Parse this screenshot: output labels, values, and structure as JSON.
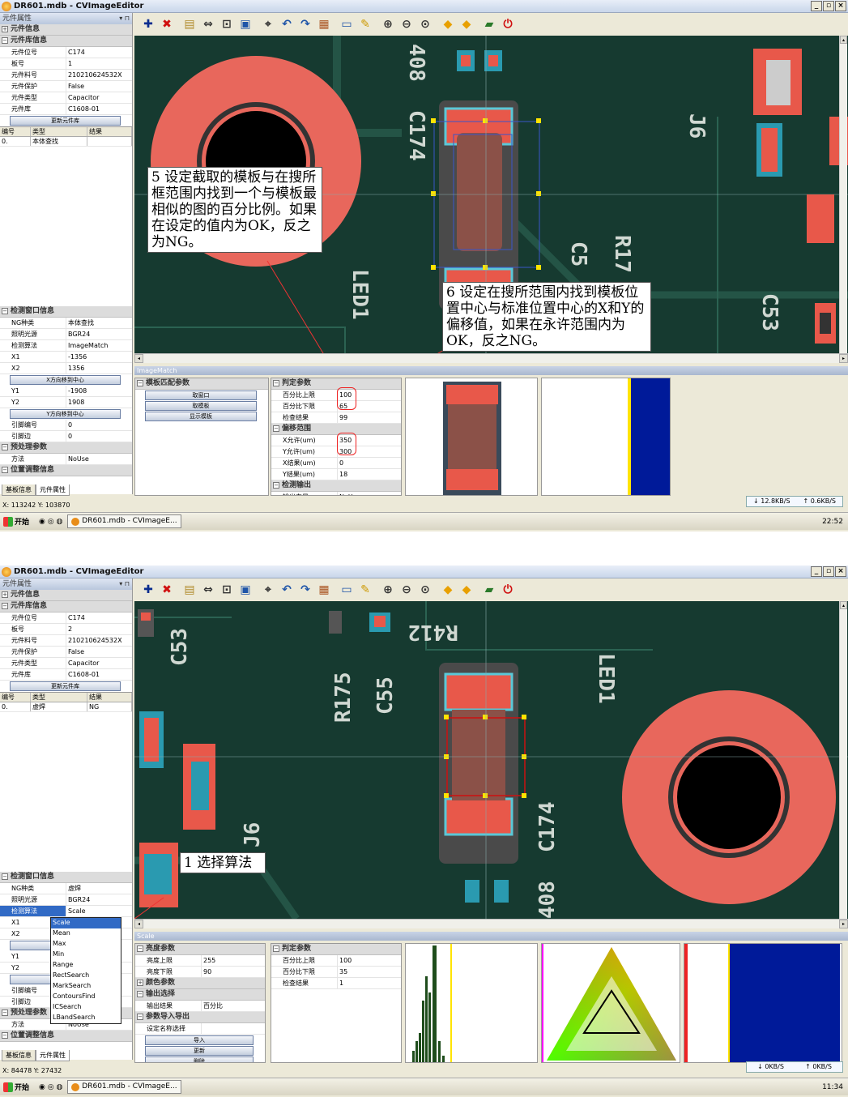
{
  "screen_top": {
    "window_title": "DR601.mdb - CVImageEditor",
    "left_panel_title": "元件属性",
    "sections_top": [
      {
        "label": "元件信息",
        "sign": "+"
      },
      {
        "label": "元件库信息",
        "sign": "−"
      }
    ],
    "component_rows": [
      {
        "k": "元件位号",
        "v": "C174"
      },
      {
        "k": "板号",
        "v": "1"
      },
      {
        "k": "元件料号",
        "v": "21021062453​2X"
      },
      {
        "k": "元件保护",
        "v": "False"
      },
      {
        "k": "元件类型",
        "v": "Capacitor"
      },
      {
        "k": "元件库",
        "v": "C1608-01"
      }
    ],
    "update_button": "更新元件库",
    "grid_headers": [
      "编号",
      "类型",
      "结果"
    ],
    "grid_rows": [
      {
        "id": "0.",
        "type": "本体查找",
        "result": ""
      }
    ],
    "detect_section": "检测窗口信息",
    "detect_rows": [
      {
        "k": "NG种类",
        "v": "本体查找"
      },
      {
        "k": "照明光源",
        "v": "BGR24"
      },
      {
        "k": "检测算法",
        "v": "ImageMatch"
      },
      {
        "k": "X1",
        "v": "-1356"
      },
      {
        "k": "X2",
        "v": "1356"
      }
    ],
    "x_center_button": "X方向移到中心",
    "detect_rows_2": [
      {
        "k": "Y1",
        "v": "-1908"
      },
      {
        "k": "Y2",
        "v": "1908"
      }
    ],
    "y_center_button": "Y方向移到中心",
    "detect_rows_3": [
      {
        "k": "引脚编号",
        "v": "0"
      },
      {
        "k": "引脚边",
        "v": "0"
      }
    ],
    "pre_section": "预处理参数",
    "pre_rows": [
      {
        "k": "方法",
        "v": "NoUse"
      }
    ],
    "pos_section": "位置调整信息",
    "tabs": [
      "基板信息",
      "元件属性"
    ],
    "status_coords": "X: 113242 Y: 103870",
    "bottom_title": "ImageMatch",
    "tm_section": "模板匹配参数",
    "tm_buttons": [
      "取窗口",
      "取模板",
      "显示模板"
    ],
    "judge_section": "判定参数",
    "judge_rows": [
      {
        "k": "百分比上限",
        "v": "100"
      },
      {
        "k": "百分比下限",
        "v": "65"
      },
      {
        "k": "检查结果",
        "v": "99"
      }
    ],
    "offset_section": "偏移范围",
    "offset_rows": [
      {
        "k": "X允许(um)",
        "v": "350"
      },
      {
        "k": "Y允许(um)",
        "v": "300"
      },
      {
        "k": "X结果(um)",
        "v": "0"
      },
      {
        "k": "Y结果(um)",
        "v": "18"
      }
    ],
    "output_section": "检测输出",
    "output_rows": [
      {
        "k": "输出向量",
        "v": "NoUse"
      }
    ],
    "callout5": "5 设定截取的模板与在搜所框范围内找到一个与模板最相似的图的百分比例。如果在设定的值内为OK，反之为NG。",
    "callout6": "6 设定在搜所范围内找到模板位置中心与标准位置中心的X和Y的偏移值，如果在永许范围内为OK，反之NG。",
    "silk_labels": [
      "LED1",
      "C174",
      "C5",
      "R17",
      "J6",
      "C53",
      "408"
    ],
    "net_down": "12.8KB/S",
    "net_up": "0.6KB/S",
    "start": "开始",
    "task_item": "DR601.mdb - CVImageE...",
    "clock": "22:52"
  },
  "screen_bottom": {
    "window_title": "DR601.mdb - CVImageEditor",
    "left_panel_title": "元件属性",
    "sections_top": [
      {
        "label": "元件信息",
        "sign": "+"
      },
      {
        "label": "元件库信息",
        "sign": "−"
      }
    ],
    "component_rows": [
      {
        "k": "元件位号",
        "v": "C174"
      },
      {
        "k": "板号",
        "v": "2"
      },
      {
        "k": "元件料号",
        "v": "21021062453​2X"
      },
      {
        "k": "元件保护",
        "v": "False"
      },
      {
        "k": "元件类型",
        "v": "Capacitor"
      },
      {
        "k": "元件库",
        "v": "C1608-01"
      }
    ],
    "update_button": "更新元件库",
    "grid_headers": [
      "编号",
      "类型",
      "结果"
    ],
    "grid_rows": [
      {
        "id": "0.",
        "type": "虚焊",
        "result": "NG"
      }
    ],
    "detect_section": "检测窗口信息",
    "detect_rows": [
      {
        "k": "NG种类",
        "v": "虚焊"
      },
      {
        "k": "照明光源",
        "v": "BGR24"
      },
      {
        "k": "检测算法",
        "v": "Scale"
      },
      {
        "k": "X1",
        "v": ""
      },
      {
        "k": "X2",
        "v": ""
      }
    ],
    "detect_rows_2": [
      {
        "k": "Y1",
        "v": ""
      },
      {
        "k": "Y2",
        "v": ""
      }
    ],
    "detect_rows_3": [
      {
        "k": "引脚编号",
        "v": ""
      },
      {
        "k": "引脚边",
        "v": ""
      }
    ],
    "pre_section": "预处理参数",
    "pre_rows": [
      {
        "k": "方法",
        "v": "NoUse"
      }
    ],
    "pos_section": "位置调整信息",
    "algo_options": [
      "Scale",
      "Mean",
      "Max",
      "Min",
      "Range",
      "RectSearch",
      "MarkSearch",
      "ContoursFind",
      "ICSearch",
      "LBandSearch"
    ],
    "tabs": [
      "基板信息",
      "元件属性"
    ],
    "status_coords": "X: 84478 Y: 27432",
    "bottom_title": "Scale",
    "bright_section": "亮度参数",
    "bright_rows": [
      {
        "k": "亮度上限",
        "v": "255"
      },
      {
        "k": "亮度下限",
        "v": "90"
      }
    ],
    "color_section": "颜色参数",
    "out_section": "输出选择",
    "out_rows": [
      {
        "k": "输出结果",
        "v": "百分比"
      }
    ],
    "io_section": "参数导入导出",
    "io_rows": [
      {
        "k": "设定名称选择",
        "v": ""
      }
    ],
    "io_buttons": [
      "导入",
      "更新",
      "删除"
    ],
    "judge_section": "判定参数",
    "judge_rows": [
      {
        "k": "百分比上限",
        "v": "100"
      },
      {
        "k": "百分比下限",
        "v": "35"
      },
      {
        "k": "检查结果",
        "v": "1"
      }
    ],
    "callout1": "1 选择算法",
    "silk_labels": [
      "C53",
      "R412",
      "R175",
      "C55",
      "LED1",
      "J6",
      "C174",
      "408"
    ],
    "net_down": "0KB/S",
    "net_up": "0KB/S",
    "start": "开始",
    "task_item": "DR601.mdb - CVImageE...",
    "clock": "11:34"
  },
  "icons": [
    "add-icon",
    "delete-icon",
    "open-icon",
    "fit-icon",
    "center-icon",
    "zoom-window-icon",
    "measure-icon",
    "undo-icon",
    "redo-icon",
    "book-icon",
    "save-icon",
    "folder-icon",
    "zoom-in-icon",
    "zoom-out-icon",
    "zoom-page-icon",
    "arrow-left-icon",
    "arrow-right-icon",
    "export-icon",
    "power-icon"
  ],
  "colors": {
    "board": "#163a30",
    "pad": "#e8584a",
    "ring": "#e8675c",
    "selection": "#ffe400",
    "accent": "#316ac5"
  }
}
